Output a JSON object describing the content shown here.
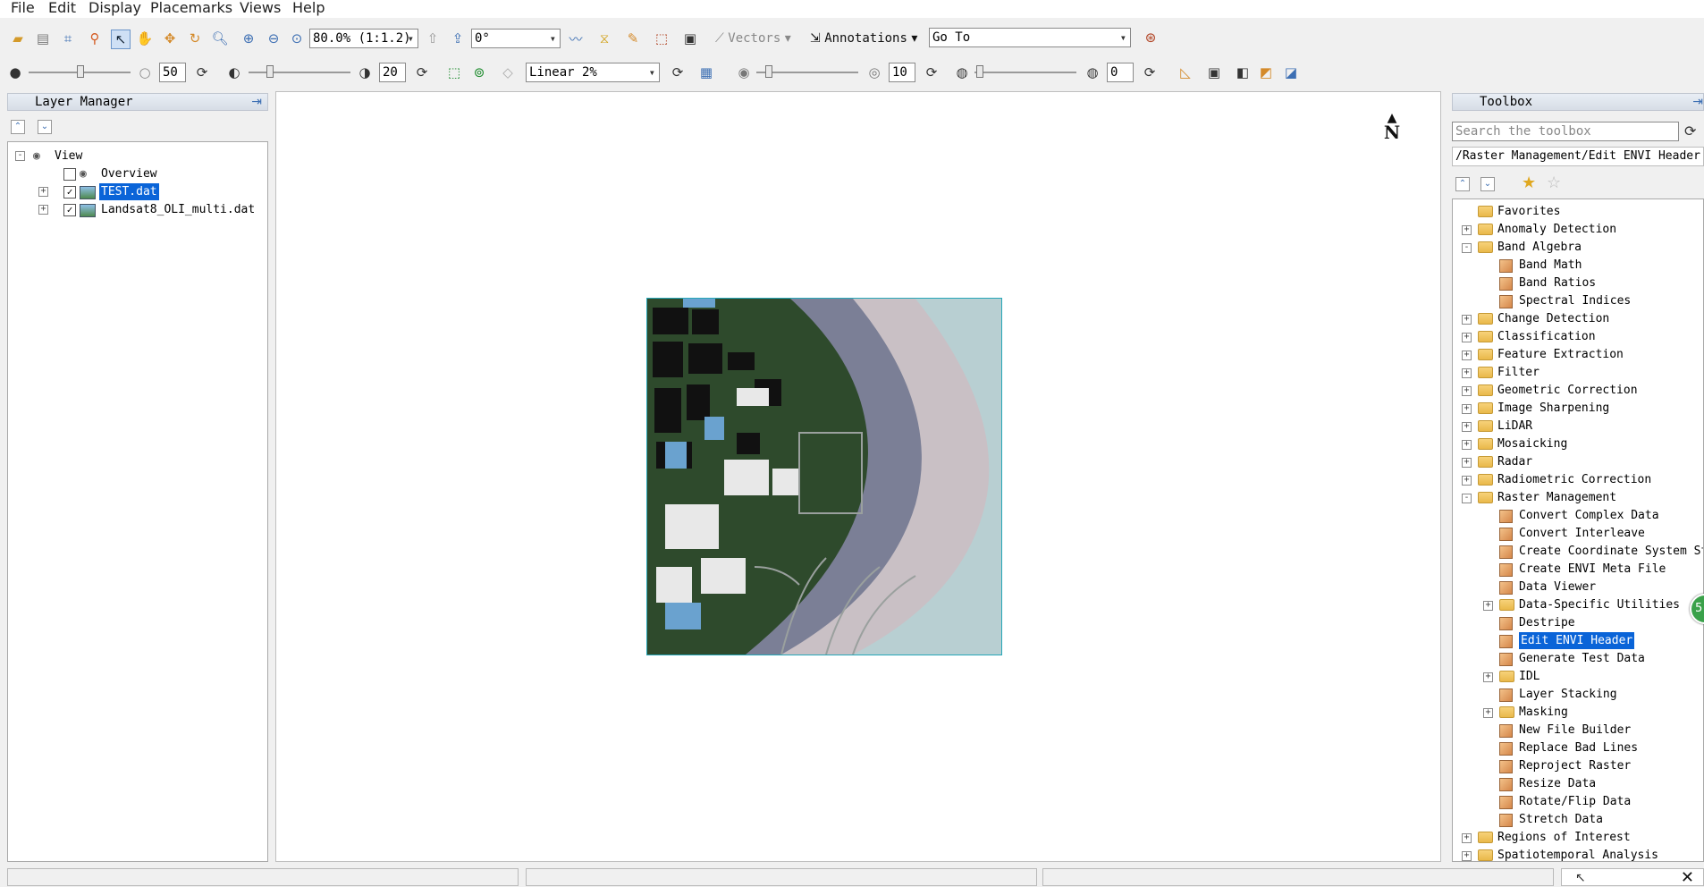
{
  "menu": [
    "File",
    "Edit",
    "Display",
    "Placemarks",
    "Views",
    "Help"
  ],
  "toolbar1": {
    "zoom_value": "80.0% (1:1.2)",
    "rotation_value": "0°",
    "vectors_label": "Vectors",
    "annotations_label": "Annotations",
    "goto_value": "Go To"
  },
  "toolbar2": {
    "brightness_value": "50",
    "contrast_value": "20",
    "stretch_value": "Linear 2%",
    "sharpen_value": "10",
    "transparency_value": "0"
  },
  "layer_manager": {
    "title": "Layer Manager",
    "root": "View",
    "items": [
      {
        "label": "Overview",
        "checked": false,
        "selected": false
      },
      {
        "label": "TEST.dat",
        "checked": true,
        "selected": true
      },
      {
        "label": "Landsat8_OLI_multi.dat",
        "checked": true,
        "selected": false
      }
    ]
  },
  "view": {
    "north_label": "N",
    "image_colors": {
      "land": "#2e4a2c",
      "water": "#c7c7c4",
      "mud": "#7b7f96",
      "sea_far": "#b8cfd2"
    }
  },
  "toolbox": {
    "title": "Toolbox",
    "search_placeholder": "Search the toolbox",
    "path": "/Raster Management/Edit ENVI Header",
    "items": [
      {
        "label": "Favorites",
        "type": "folder",
        "level": 0,
        "expander": ""
      },
      {
        "label": "Anomaly Detection",
        "type": "folder",
        "level": 0,
        "expander": "+"
      },
      {
        "label": "Band Algebra",
        "type": "folder",
        "level": 0,
        "expander": "-"
      },
      {
        "label": "Band Math",
        "type": "tool",
        "level": 1,
        "expander": ""
      },
      {
        "label": "Band Ratios",
        "type": "tool",
        "level": 1,
        "expander": ""
      },
      {
        "label": "Spectral Indices",
        "type": "tool",
        "level": 1,
        "expander": ""
      },
      {
        "label": "Change Detection",
        "type": "folder",
        "level": 0,
        "expander": "+"
      },
      {
        "label": "Classification",
        "type": "folder",
        "level": 0,
        "expander": "+"
      },
      {
        "label": "Feature Extraction",
        "type": "folder",
        "level": 0,
        "expander": "+"
      },
      {
        "label": "Filter",
        "type": "folder",
        "level": 0,
        "expander": "+"
      },
      {
        "label": "Geometric Correction",
        "type": "folder",
        "level": 0,
        "expander": "+"
      },
      {
        "label": "Image Sharpening",
        "type": "folder",
        "level": 0,
        "expander": "+"
      },
      {
        "label": "LiDAR",
        "type": "folder",
        "level": 0,
        "expander": "+"
      },
      {
        "label": "Mosaicking",
        "type": "folder",
        "level": 0,
        "expander": "+"
      },
      {
        "label": "Radar",
        "type": "folder",
        "level": 0,
        "expander": "+"
      },
      {
        "label": "Radiometric Correction",
        "type": "folder",
        "level": 0,
        "expander": "+"
      },
      {
        "label": "Raster Management",
        "type": "folder",
        "level": 0,
        "expander": "-"
      },
      {
        "label": "Convert Complex Data",
        "type": "tool",
        "level": 1,
        "expander": ""
      },
      {
        "label": "Convert Interleave",
        "type": "tool",
        "level": 1,
        "expander": ""
      },
      {
        "label": "Create Coordinate System St",
        "type": "tool",
        "level": 1,
        "expander": ""
      },
      {
        "label": "Create ENVI Meta File",
        "type": "tool",
        "level": 1,
        "expander": ""
      },
      {
        "label": "Data Viewer",
        "type": "tool",
        "level": 1,
        "expander": ""
      },
      {
        "label": "Data-Specific Utilities",
        "type": "folder",
        "level": 1,
        "expander": "+"
      },
      {
        "label": "Destripe",
        "type": "tool",
        "level": 1,
        "expander": ""
      },
      {
        "label": "Edit ENVI Header",
        "type": "tool",
        "level": 1,
        "expander": "",
        "selected": true
      },
      {
        "label": "Generate Test Data",
        "type": "tool",
        "level": 1,
        "expander": ""
      },
      {
        "label": "IDL",
        "type": "folder",
        "level": 1,
        "expander": "+"
      },
      {
        "label": "Layer Stacking",
        "type": "tool",
        "level": 1,
        "expander": ""
      },
      {
        "label": "Masking",
        "type": "folder",
        "level": 1,
        "expander": "+"
      },
      {
        "label": "New File Builder",
        "type": "tool",
        "level": 1,
        "expander": ""
      },
      {
        "label": "Replace Bad Lines",
        "type": "tool",
        "level": 1,
        "expander": ""
      },
      {
        "label": "Reproject Raster",
        "type": "tool",
        "level": 1,
        "expander": ""
      },
      {
        "label": "Resize Data",
        "type": "tool",
        "level": 1,
        "expander": ""
      },
      {
        "label": "Rotate/Flip Data",
        "type": "tool",
        "level": 1,
        "expander": ""
      },
      {
        "label": "Stretch Data",
        "type": "tool",
        "level": 1,
        "expander": ""
      },
      {
        "label": "Regions of Interest",
        "type": "folder",
        "level": 0,
        "expander": "+"
      },
      {
        "label": "Spatiotemporal Analysis",
        "type": "folder",
        "level": 0,
        "expander": "+"
      }
    ]
  },
  "floating_badge": "5"
}
